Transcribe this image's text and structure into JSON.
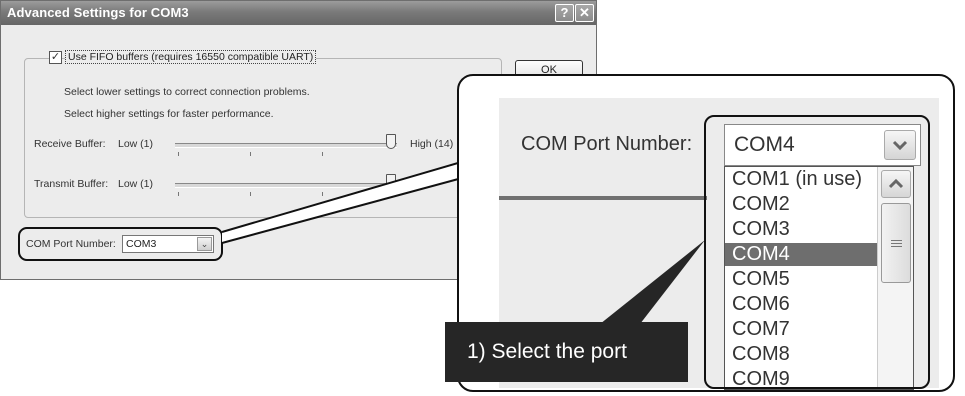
{
  "dialog": {
    "title": "Advanced Settings for COM3",
    "help_glyph": "?",
    "close_glyph": "✕",
    "fifo_label": "Use FIFO buffers (requires 16550 compatible UART)",
    "fifo_checked": true,
    "hint_lower": "Select lower settings to correct connection problems.",
    "hint_higher": "Select higher settings for faster performance.",
    "receive_label": "Receive Buffer:",
    "receive_low": "Low (1)",
    "receive_high": "High (14)",
    "transmit_label": "Transmit Buffer:",
    "transmit_low": "Low (1)",
    "ok_label": "OK",
    "com_port_label": "COM Port Number:",
    "com_port_value": "COM3"
  },
  "zoom": {
    "com_port_label": "COM Port Number:",
    "selected_value": "COM4",
    "options": [
      "COM1 (in use)",
      "COM2",
      "COM3",
      "COM4",
      "COM5",
      "COM6",
      "COM7",
      "COM8",
      "COM9"
    ],
    "highlighted_index": 3
  },
  "callout": {
    "step_text": "1) Select the port"
  },
  "colors": {
    "titlebar": "#7a7a7a",
    "selection": "#6e6e6e",
    "callout_fill": "#262626"
  }
}
